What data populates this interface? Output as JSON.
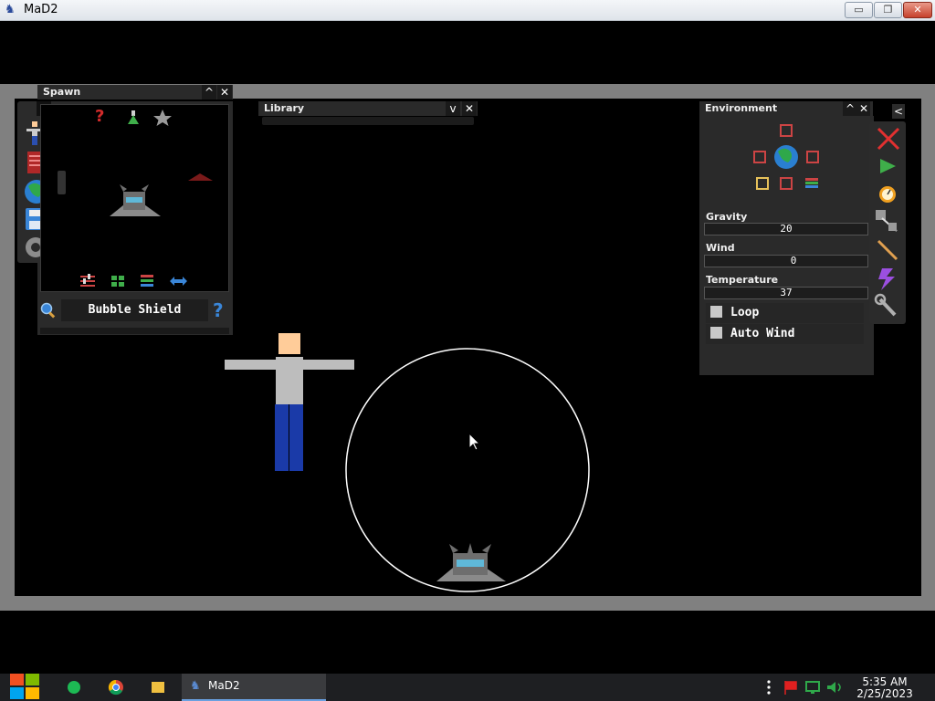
{
  "window": {
    "title": "MaD2",
    "min_glyph": "▭",
    "max_glyph": "❐",
    "close_glyph": "✕"
  },
  "spawn_panel": {
    "title": "Spawn",
    "collapse_glyph": "^",
    "close_glyph": "✕",
    "expand_glyph": ">",
    "selected_item": "Bubble Shield",
    "help_glyph": "?",
    "random_glyph": "?",
    "tabs": [
      "figure",
      "book",
      "globe",
      "disk",
      "gear"
    ]
  },
  "library_panel": {
    "title": "Library",
    "dropdown_glyph": "v",
    "close_glyph": "✕"
  },
  "environment_panel": {
    "title": "Environment",
    "collapse_glyph": "^",
    "close_glyph": "✕",
    "gravity": {
      "label": "Gravity",
      "value": "20"
    },
    "wind": {
      "label": "Wind",
      "value": "0"
    },
    "temperature": {
      "label": "Temperature",
      "value": "37"
    },
    "loop": {
      "label": "Loop",
      "checked": false
    },
    "auto_wind": {
      "label": "Auto Wind",
      "checked": false
    }
  },
  "tool_bar": {
    "collapse_glyph": "<",
    "tools": [
      "delete",
      "play",
      "timer",
      "drag",
      "knife",
      "lightning",
      "wrench"
    ]
  },
  "taskbar": {
    "app_label": "MaD2",
    "time": "5:35 AM",
    "date": "2/25/2023"
  },
  "colors": {
    "skin": "#ffcc99",
    "shirt": "#bdbdbd",
    "pants": "#1a3aa8",
    "bubble": "#ffffff",
    "viewport_border": "#808080"
  }
}
